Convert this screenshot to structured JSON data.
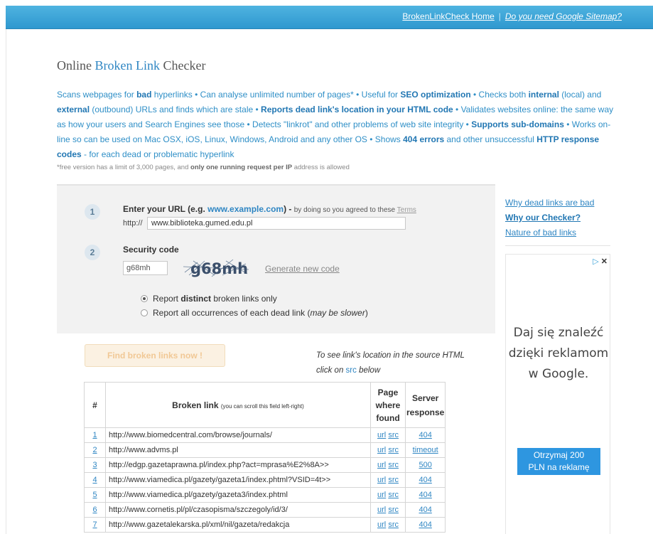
{
  "header": {
    "home_link": "BrokenLinkCheck Home",
    "separator": "|",
    "sitemap_link": "Do you need Google Sitemap?",
    "color": "#2f98cf"
  },
  "title": {
    "pre": "Online ",
    "highlight": "Broken Link",
    "post": " Checker"
  },
  "description": [
    {
      "t": "Scans webpages for "
    },
    {
      "t": "bad",
      "b": true
    },
    {
      "t": " hyperlinks • Can analyse unlimited number of pages* • Useful for "
    },
    {
      "t": "SEO optimization",
      "b": true
    },
    {
      "t": " • Checks both "
    },
    {
      "t": "internal",
      "b": true
    },
    {
      "t": " (local) and "
    },
    {
      "t": "external",
      "b": true
    },
    {
      "t": " (outbound) URLs and finds which are stale • "
    },
    {
      "t": "Reports dead link's location in your HTML code",
      "b": true
    },
    {
      "t": " • Validates websites online: the same way as how your users and Search Engines see those • Detects \"linkrot\" and other problems of web site integrity • "
    },
    {
      "t": "Supports sub-domains",
      "b": true
    },
    {
      "t": " • Works on-line so can be used on Mac OSX, iOS, Linux, Windows, Android and any other OS • Shows "
    },
    {
      "t": "404 errors",
      "b": true
    },
    {
      "t": " and other unsuccessful "
    },
    {
      "t": "HTTP response codes",
      "b": true
    },
    {
      "t": " - for each dead or problematic hyperlink"
    }
  ],
  "note": {
    "pre": "*free version has a limit of 3,000 pages, and ",
    "bold": "only one running request per IP",
    "post": " address is allowed"
  },
  "form": {
    "step1": "1",
    "url_label": "Enter your URL (e.g. ",
    "url_example": "www.example.com",
    "url_label_end": ") - ",
    "agree_text": "by doing so you agreed to these ",
    "terms": "Terms",
    "url_prefix": "http://",
    "url_value": "www.biblioteka.gumed.edu.pl",
    "step2": "2",
    "security_label": "Security code",
    "code_value": "g68mh",
    "captcha_text": "g68mh",
    "generate": "Generate new code",
    "radio1_pre": "Report ",
    "radio1_bold": "distinct",
    "radio1_post": " broken links only",
    "radio2_pre": "Report all occurrences of each dead link (",
    "radio2_italic": "may be slower",
    "radio2_post": ")",
    "button": "Find broken links now !",
    "hint_line1": "To see link's location in the source HTML",
    "hint_line2_pre": "click on ",
    "hint_src": "src",
    "hint_line2_post": " below"
  },
  "table": {
    "headers": {
      "num": "#",
      "link": "Broken link",
      "link_small": "(you can scroll this field left-right)",
      "page": "Page where found",
      "server": "Server response"
    },
    "rows": [
      {
        "n": "1",
        "url": "http://www.biomedcentral.com/browse/journals/",
        "a": "url",
        "b": "src",
        "r": "404"
      },
      {
        "n": "2",
        "url": "http://www.advms.pl",
        "a": "url",
        "b": "src",
        "r": "timeout"
      },
      {
        "n": "3",
        "url": "http://edgp.gazetaprawna.pl/index.php?act=mprasa%E2%8A>>",
        "a": "url",
        "b": "src",
        "r": "500"
      },
      {
        "n": "4",
        "url": "http://www.viamedica.pl/gazety/gazeta1/index.phtml?VSID=4t>>",
        "a": "url",
        "b": "src",
        "r": "404"
      },
      {
        "n": "5",
        "url": "http://www.viamedica.pl/gazety/gazeta3/index.phtml",
        "a": "url",
        "b": "src",
        "r": "404"
      },
      {
        "n": "6",
        "url": "http://www.cornetis.pl/pl/czasopisma/szczegoly/id/3/",
        "a": "url",
        "b": "src",
        "r": "404"
      },
      {
        "n": "7",
        "url": "http://www.gazetalekarska.pl/xml/nil/gazeta/redakcja",
        "a": "url",
        "b": "src",
        "r": "404"
      }
    ]
  },
  "sidebar": {
    "link1": "Why dead links are bad",
    "link2": "Why our Checker?",
    "link3": "Nature of bad links"
  },
  "ad": {
    "choices_icon": "adchoices-icon",
    "tri": "▷",
    "close": "✕",
    "line1": "Daj się znaleźć",
    "line2": "dzięki reklamom",
    "line3": "w Google.",
    "btn_line1": "Otrzymaj 200",
    "btn_line2": "PLN na reklamę"
  }
}
